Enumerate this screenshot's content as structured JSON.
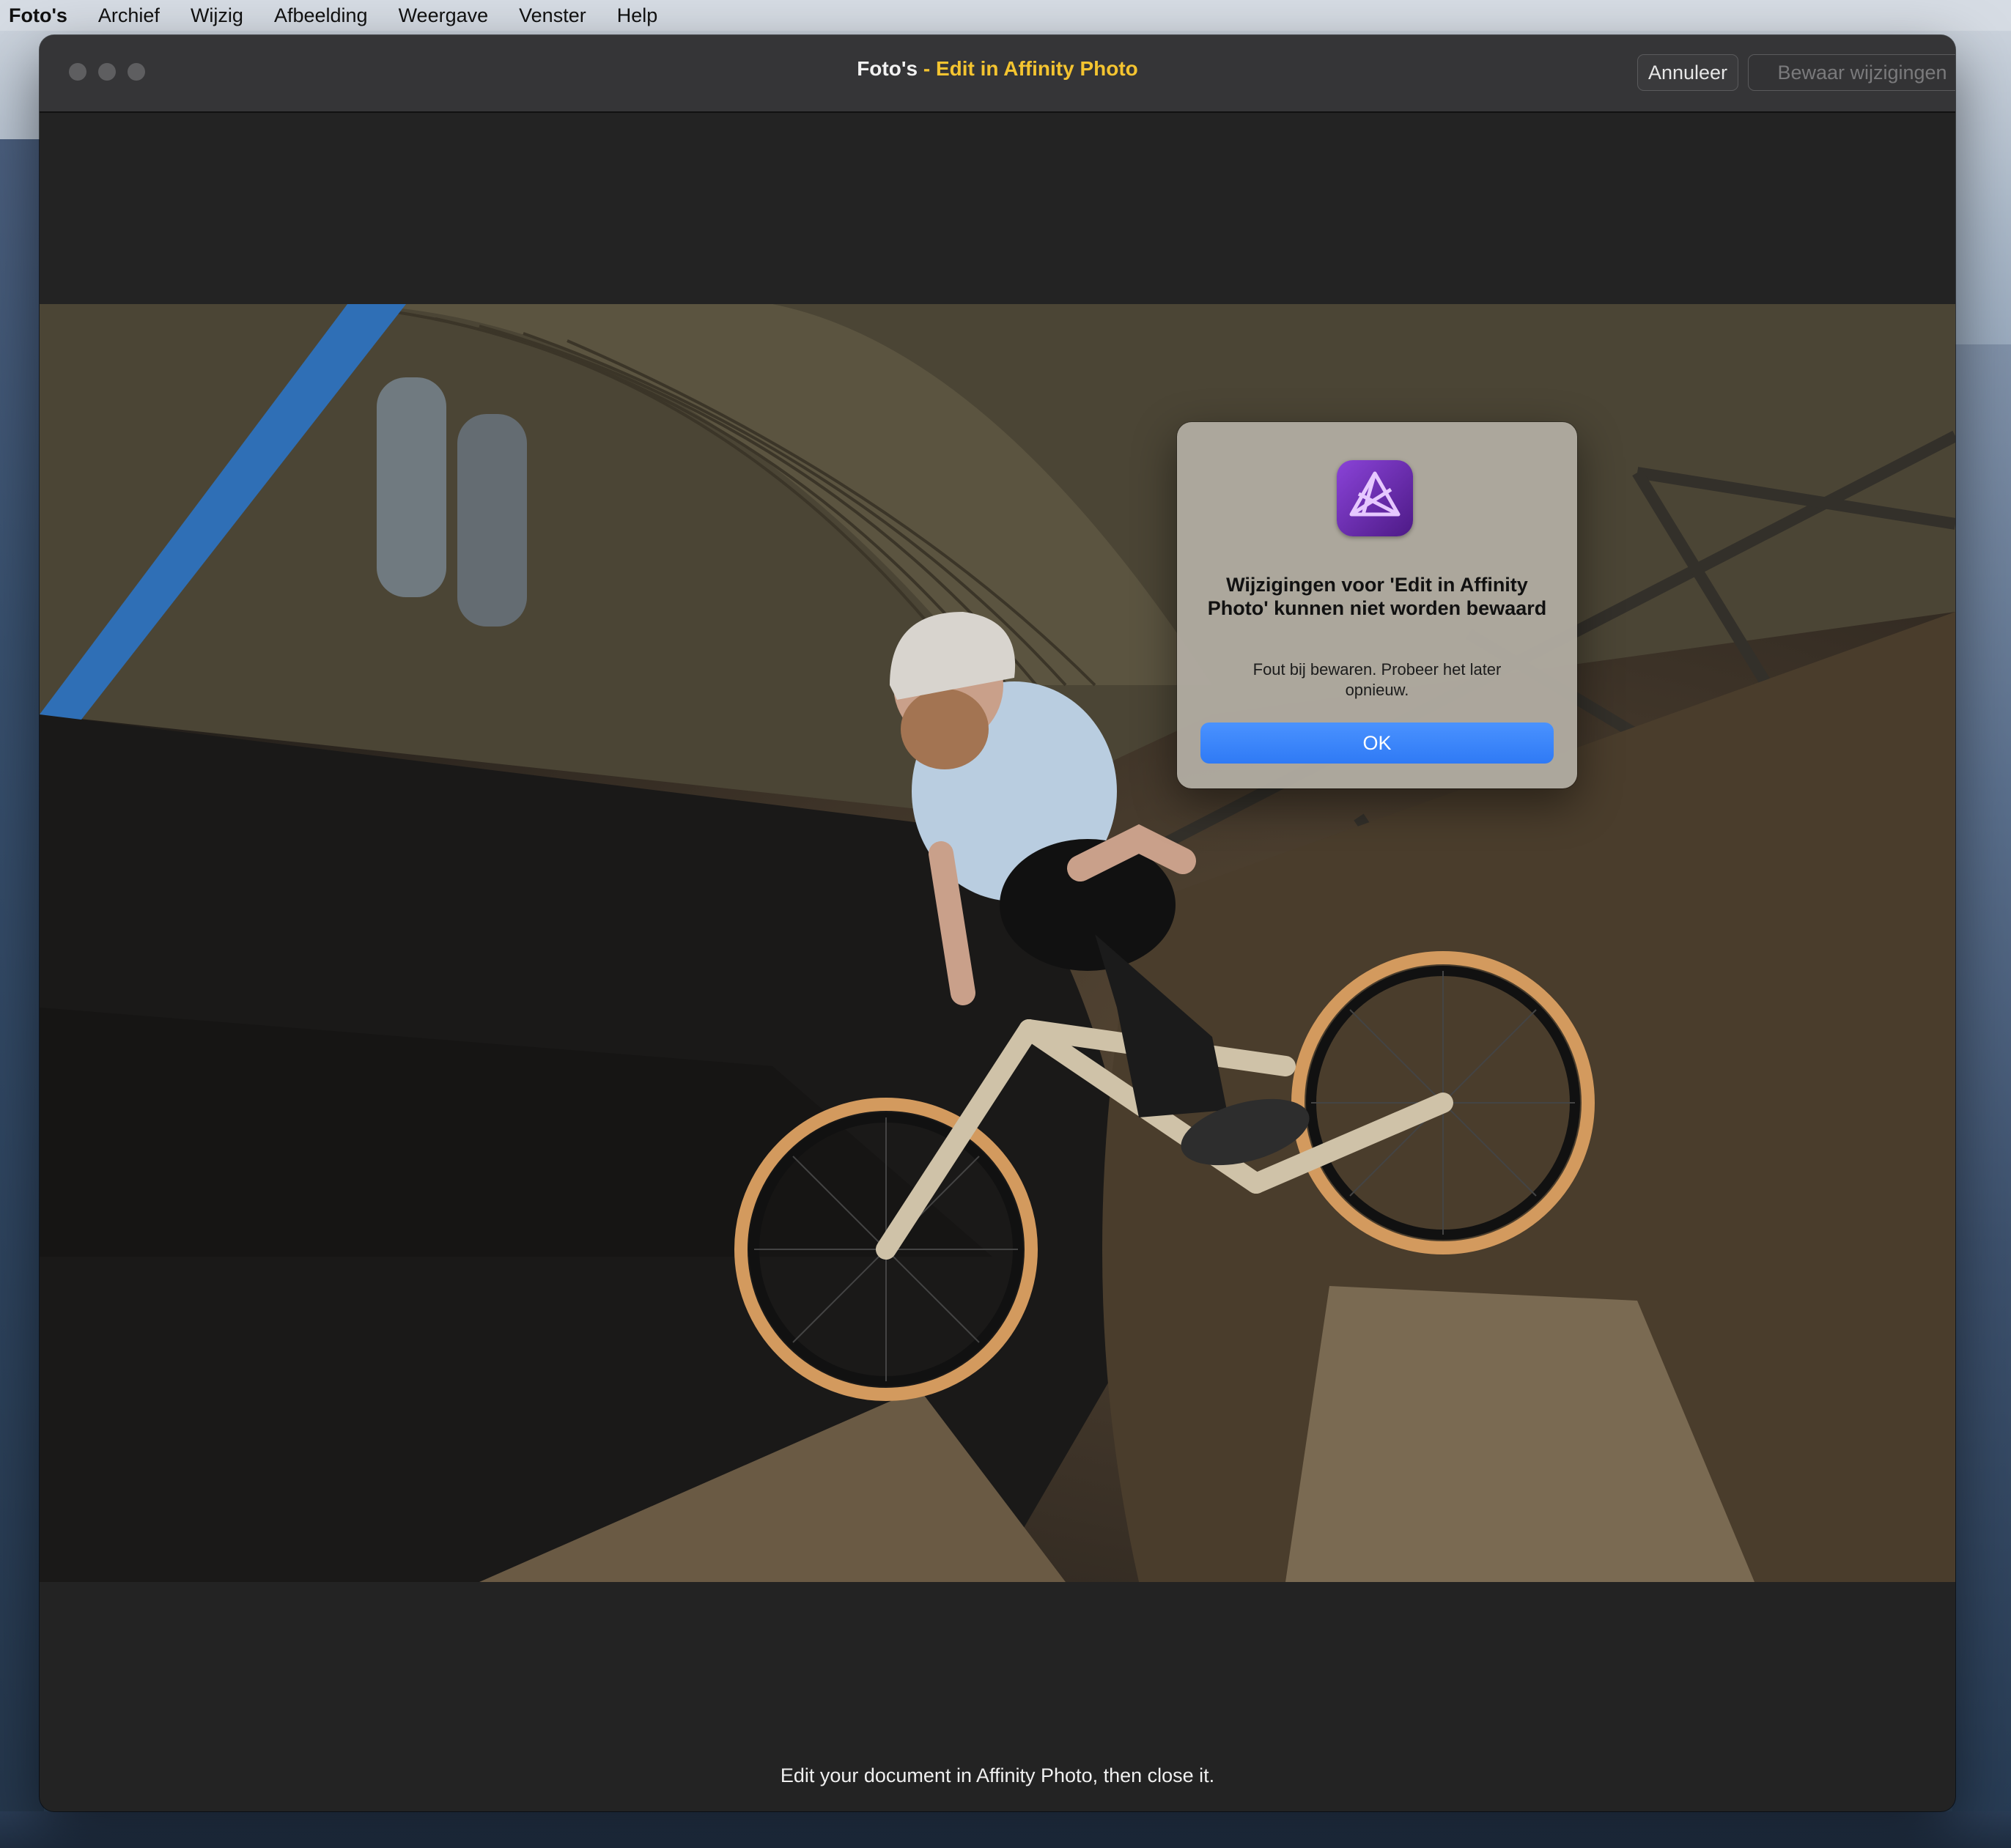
{
  "menubar": {
    "app_name": "Foto's",
    "items": [
      "Archief",
      "Wijzig",
      "Afbeelding",
      "Weergave",
      "Venster",
      "Help"
    ]
  },
  "window": {
    "title_app": "Foto's",
    "title_separator": " - ",
    "title_extension": "Edit in Affinity Photo",
    "cancel_label": "Annuleer",
    "save_label": "Bewaar wijzigingen",
    "footer_message": "Edit your document in Affinity Photo, then close it."
  },
  "dialog": {
    "icon": "affinity-photo-icon",
    "title": "Wijzigingen voor 'Edit in Affinity Photo' kunnen niet worden bewaard",
    "message": "Fout bij bewaren. Probeer het later opnieuw.",
    "ok_label": "OK"
  },
  "colors": {
    "accent_title": "#f4c430",
    "ok_button": "#3b86fb"
  }
}
